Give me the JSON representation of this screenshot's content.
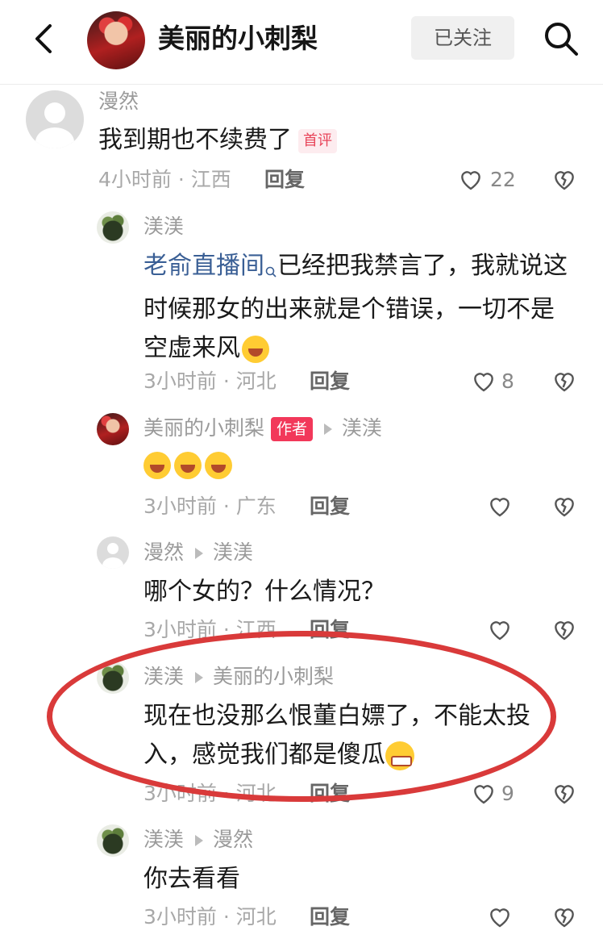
{
  "header": {
    "title": "美丽的小刺梨",
    "follow_label": "已关注"
  },
  "comments": [
    {
      "user": "漫然",
      "text": "我到期也不续费了",
      "tag": "首评",
      "time": "4小时前",
      "location": "江西",
      "reply_label": "回复",
      "likes": "22"
    }
  ],
  "replies": [
    {
      "user": "渼渼",
      "mention": "老俞直播间",
      "line1": "已经把我禁言了，我就说这",
      "line2": "时候那女的出来就是个错误，一切不是",
      "line3": "空虚来风",
      "time": "3小时前",
      "location": "河北",
      "reply_label": "回复",
      "likes": "8"
    },
    {
      "user": "美丽的小刺梨",
      "tag": "作者",
      "to": "渼渼",
      "time": "3小时前",
      "location": "广东",
      "reply_label": "回复"
    },
    {
      "user": "漫然",
      "to": "渼渼",
      "text": "哪个女的？什么情况？",
      "time": "3小时前",
      "location": "江西",
      "reply_label": "回复"
    },
    {
      "user": "渼渼",
      "to": "美丽的小刺梨",
      "line1": "现在也没那么恨董白嫖了，不能太投",
      "line2": "入，感觉我们都是傻瓜",
      "time": "3小时前",
      "location": "河北",
      "reply_label": "回复",
      "likes": "9"
    },
    {
      "user": "渼渼",
      "to": "漫然",
      "text": "你去看看",
      "time": "3小时前",
      "location": "河北",
      "reply_label": "回复"
    }
  ],
  "icons": {
    "back": "chevron-left-icon",
    "search": "search-icon",
    "like": "heart-icon",
    "dislike": "broken-heart-icon",
    "arrow": "triangle-right-icon"
  },
  "colors": {
    "highlight_ellipse": "#d93a3a",
    "author_tag": "#f2385a",
    "first_comment_tag": "#e8455a",
    "mention_link": "#3a5f95"
  }
}
